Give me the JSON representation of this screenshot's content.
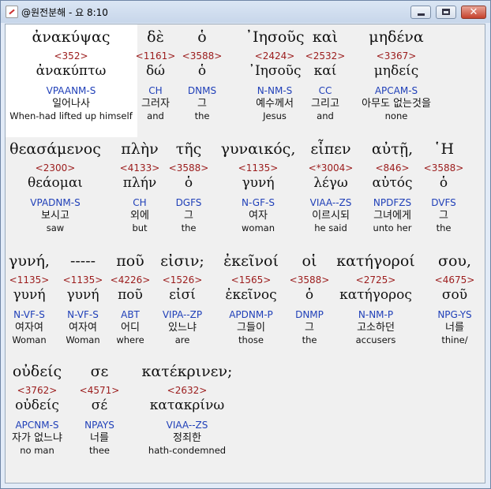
{
  "window": {
    "title": "@원전분해 - 요 8:10",
    "app_icon": "app-icon",
    "minimize_icon": "minimize-icon",
    "maximize_icon": "maximize-icon",
    "close_icon": "close-icon",
    "close_glyph": "✕"
  },
  "colors": {
    "strong": "#9b1b1b",
    "morph": "#1f3fb8",
    "highlight": "#ffffff",
    "background": "#f0f0f0"
  },
  "rows": [
    {
      "tokens": [
        {
          "surface": "ἀνακύψας",
          "strong": "<352>",
          "lemma": "ἀνακύπτω",
          "morph": "VPAANM-S",
          "korean": "일어나사",
          "english": "When-had lifted up himself",
          "selected": true
        },
        {
          "surface": "δὲ",
          "strong": "<1161>",
          "lemma": "δώ",
          "morph": "CH",
          "korean": "그러자",
          "english": "and"
        },
        {
          "surface": "ὁ",
          "strong": "<3588>",
          "lemma": "ὁ",
          "morph": "DNMS",
          "korean": "그",
          "english": "the"
        },
        {
          "surface": "᾿Ιησοῦς",
          "strong": "<2424>",
          "lemma": "᾿Ιησοῦς",
          "morph": "N-NM-S",
          "korean": "예수께서",
          "english": "Jesus"
        },
        {
          "surface": "καὶ",
          "strong": "<2532>",
          "lemma": "καί",
          "morph": "CC",
          "korean": "그리고",
          "english": "and"
        },
        {
          "surface": "μηδένα",
          "strong": "<3367>",
          "lemma": "μηδείς",
          "morph": "APCAM-S",
          "korean": "아무도 없는것을",
          "english": "none"
        }
      ]
    },
    {
      "tokens": [
        {
          "surface": "θεασάμενος",
          "strong": "<2300>",
          "lemma": "θεάομαι",
          "morph": "VPADNM-S",
          "korean": "보시고",
          "english": "saw"
        },
        {
          "surface": "πλὴν",
          "strong": "<4133>",
          "lemma": "πλήν",
          "morph": "CH",
          "korean": "외에",
          "english": "but"
        },
        {
          "surface": "τῆς",
          "strong": "<3588>",
          "lemma": "ὁ",
          "morph": "DGFS",
          "korean": "그",
          "english": "the"
        },
        {
          "surface": "γυναικός,",
          "strong": "<1135>",
          "lemma": "γυνή",
          "morph": "N-GF-S",
          "korean": "여자",
          "english": "woman"
        },
        {
          "surface": "εἶπεν",
          "strong": "<*3004>",
          "lemma": "λέγω",
          "morph": "VIAA--ZS",
          "korean": "이르시되",
          "english": "he said"
        },
        {
          "surface": "αὐτῇ,",
          "strong": "<846>",
          "lemma": "αὐτός",
          "morph": "NPDFZS",
          "korean": "그녀에게",
          "english": "unto her"
        },
        {
          "surface": "῾Η",
          "strong": "<3588>",
          "lemma": "ὁ",
          "morph": "DVFS",
          "korean": "그",
          "english": "the"
        }
      ]
    },
    {
      "tokens": [
        {
          "surface": "γυνή,",
          "strong": "<1135>",
          "lemma": "γυνή",
          "morph": "N-VF-S",
          "korean": "여자여",
          "english": "Woman"
        },
        {
          "surface": "-----",
          "strong": "<1135>",
          "lemma": "γυνή",
          "morph": "N-VF-S",
          "korean": "여자여",
          "english": "Woman"
        },
        {
          "surface": "ποῦ",
          "strong": "<4226>",
          "lemma": "ποῦ",
          "morph": "ABT",
          "korean": "어디",
          "english": "where"
        },
        {
          "surface": "εἰσιν;",
          "strong": "<1526>",
          "lemma": "εἰσί",
          "morph": "VIPA--ZP",
          "korean": "있느냐",
          "english": "are"
        },
        {
          "surface": "ἐκεῖνοί",
          "strong": "<1565>",
          "lemma": "ἐκεῖνος",
          "morph": "APDNM-P",
          "korean": "그들이",
          "english": "those"
        },
        {
          "surface": "οἱ",
          "strong": "<3588>",
          "lemma": "ὁ",
          "morph": "DNMP",
          "korean": "그",
          "english": "the"
        },
        {
          "surface": "κατήγοροί",
          "strong": "<2725>",
          "lemma": "κατήγορος",
          "morph": "N-NM-P",
          "korean": "고소하던",
          "english": "accusers"
        },
        {
          "surface": "σου,",
          "strong": "<4675>",
          "lemma": "σοῦ",
          "morph": "NPG-YS",
          "korean": "너를",
          "english": "thine/"
        }
      ]
    },
    {
      "tokens": [
        {
          "surface": "οὐδείς",
          "strong": "<3762>",
          "lemma": "οὐδείς",
          "morph": "APCNM-S",
          "korean": "자가 없느냐",
          "english": "no man"
        },
        {
          "surface": "σε",
          "strong": "<4571>",
          "lemma": "σέ",
          "morph": "NPAYS",
          "korean": "너를",
          "english": "thee"
        },
        {
          "surface": "κατέκρινεν;",
          "strong": "<2632>",
          "lemma": "κατακρίνω",
          "morph": "VIAA--ZS",
          "korean": "정죄한",
          "english": "hath-condemned"
        }
      ]
    }
  ]
}
